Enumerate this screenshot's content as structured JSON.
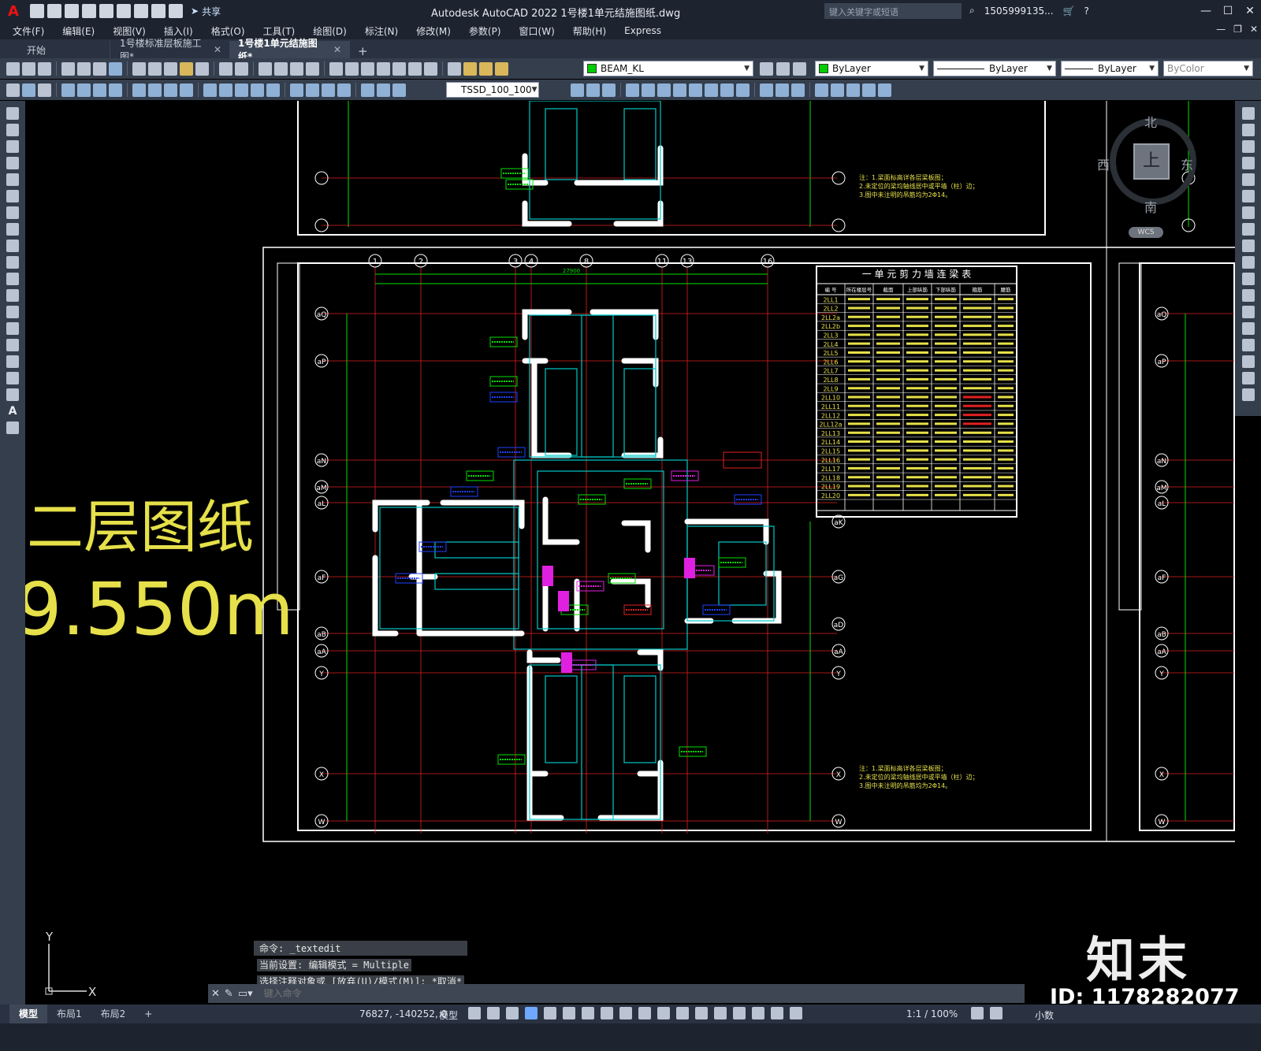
{
  "title_bar": {
    "app_logo": "A",
    "share_label": "共享",
    "app_title": "Autodesk AutoCAD 2022    1号楼1单元结施图纸.dwg",
    "search_placeholder": "键入关键字或短语",
    "user": "1505999135...",
    "window_controls": [
      "—",
      "☐",
      "✕"
    ]
  },
  "menu": {
    "items": [
      "文件(F)",
      "编辑(E)",
      "视图(V)",
      "插入(I)",
      "格式(O)",
      "工具(T)",
      "绘图(D)",
      "标注(N)",
      "修改(M)",
      "参数(P)",
      "窗口(W)",
      "帮助(H)",
      "Express"
    ]
  },
  "tabs": {
    "items": [
      {
        "label": "开始",
        "closable": false,
        "active": false
      },
      {
        "label": "1号楼标准层板施工图*",
        "closable": true,
        "active": false
      },
      {
        "label": "1号楼1单元结施图纸*",
        "closable": true,
        "active": true
      }
    ],
    "add_label": "+"
  },
  "toolbar": {
    "layer": {
      "value": "BEAM_KL",
      "color": "#00cc00"
    },
    "color": {
      "value": "ByLayer",
      "color": "#00cc00"
    },
    "linetype": {
      "value": "ByLayer"
    },
    "lineweight": {
      "value": "ByLayer"
    },
    "plotstyle": {
      "value": "ByColor"
    },
    "dimstyle": {
      "value": "TSSD_100_100"
    }
  },
  "drawing": {
    "overlay_text_1": "二层图纸",
    "overlay_text_2": "9.550m",
    "table_title": "一 单 元 剪 力 墙 连 梁 表",
    "table_headers": [
      "编 号",
      "所在楼层号",
      "截面",
      "上部纵筋",
      "下部纵筋",
      "箍筋",
      "腰筋"
    ],
    "table_rows": [
      "2LL1",
      "2LL2",
      "2LL2a",
      "2LL2b",
      "2LL3",
      "2LL4",
      "2LL5",
      "2LL6",
      "2LL7",
      "2LL8",
      "2LL9",
      "2LL10",
      "2LL11",
      "2LL12",
      "2LL12a",
      "2LL13",
      "2LL14",
      "2LL15",
      "2LL16",
      "2LL17",
      "2LL18",
      "2LL19",
      "2LL20"
    ],
    "top_axes": [
      "1",
      "2",
      "3",
      "4",
      "8",
      "11",
      "13",
      "16"
    ],
    "left_axes": [
      "aQ",
      "aP",
      "aN",
      "aM",
      "aL",
      "aF",
      "aB",
      "aA",
      "Y",
      "X",
      "W"
    ],
    "right_axes": [
      "aK",
      "aG",
      "aD",
      "aA",
      "Y",
      "X",
      "W"
    ],
    "top_dim": "27900",
    "notes": [
      "注：1.梁面标高详各层梁板图；",
      "2.未定位的梁均轴线居中或平墙（柱）边；",
      "3.图中未注明的吊筋均为2Φ14。"
    ]
  },
  "viewcube": {
    "north": "北",
    "south": "南",
    "east": "东",
    "west": "西",
    "face": "上",
    "wcs": "WCS"
  },
  "ucs": {
    "y": "Y",
    "x": "X"
  },
  "command": {
    "history": [
      "命令: _textedit",
      "当前设置: 编辑模式 = Multiple",
      "选择注释对象或 [放弃(U)/模式(M)]: *取消*"
    ],
    "placeholder": "键入命令"
  },
  "watermark": {
    "logo": "知末",
    "id": "ID: 1178282077"
  },
  "status": {
    "layouts": [
      "模型",
      "布局1",
      "布局2"
    ],
    "add_layout": "+",
    "coords": "76827, -140252, 0",
    "mode": "模型",
    "scale": "1:1 / 100%",
    "units": "小数"
  }
}
